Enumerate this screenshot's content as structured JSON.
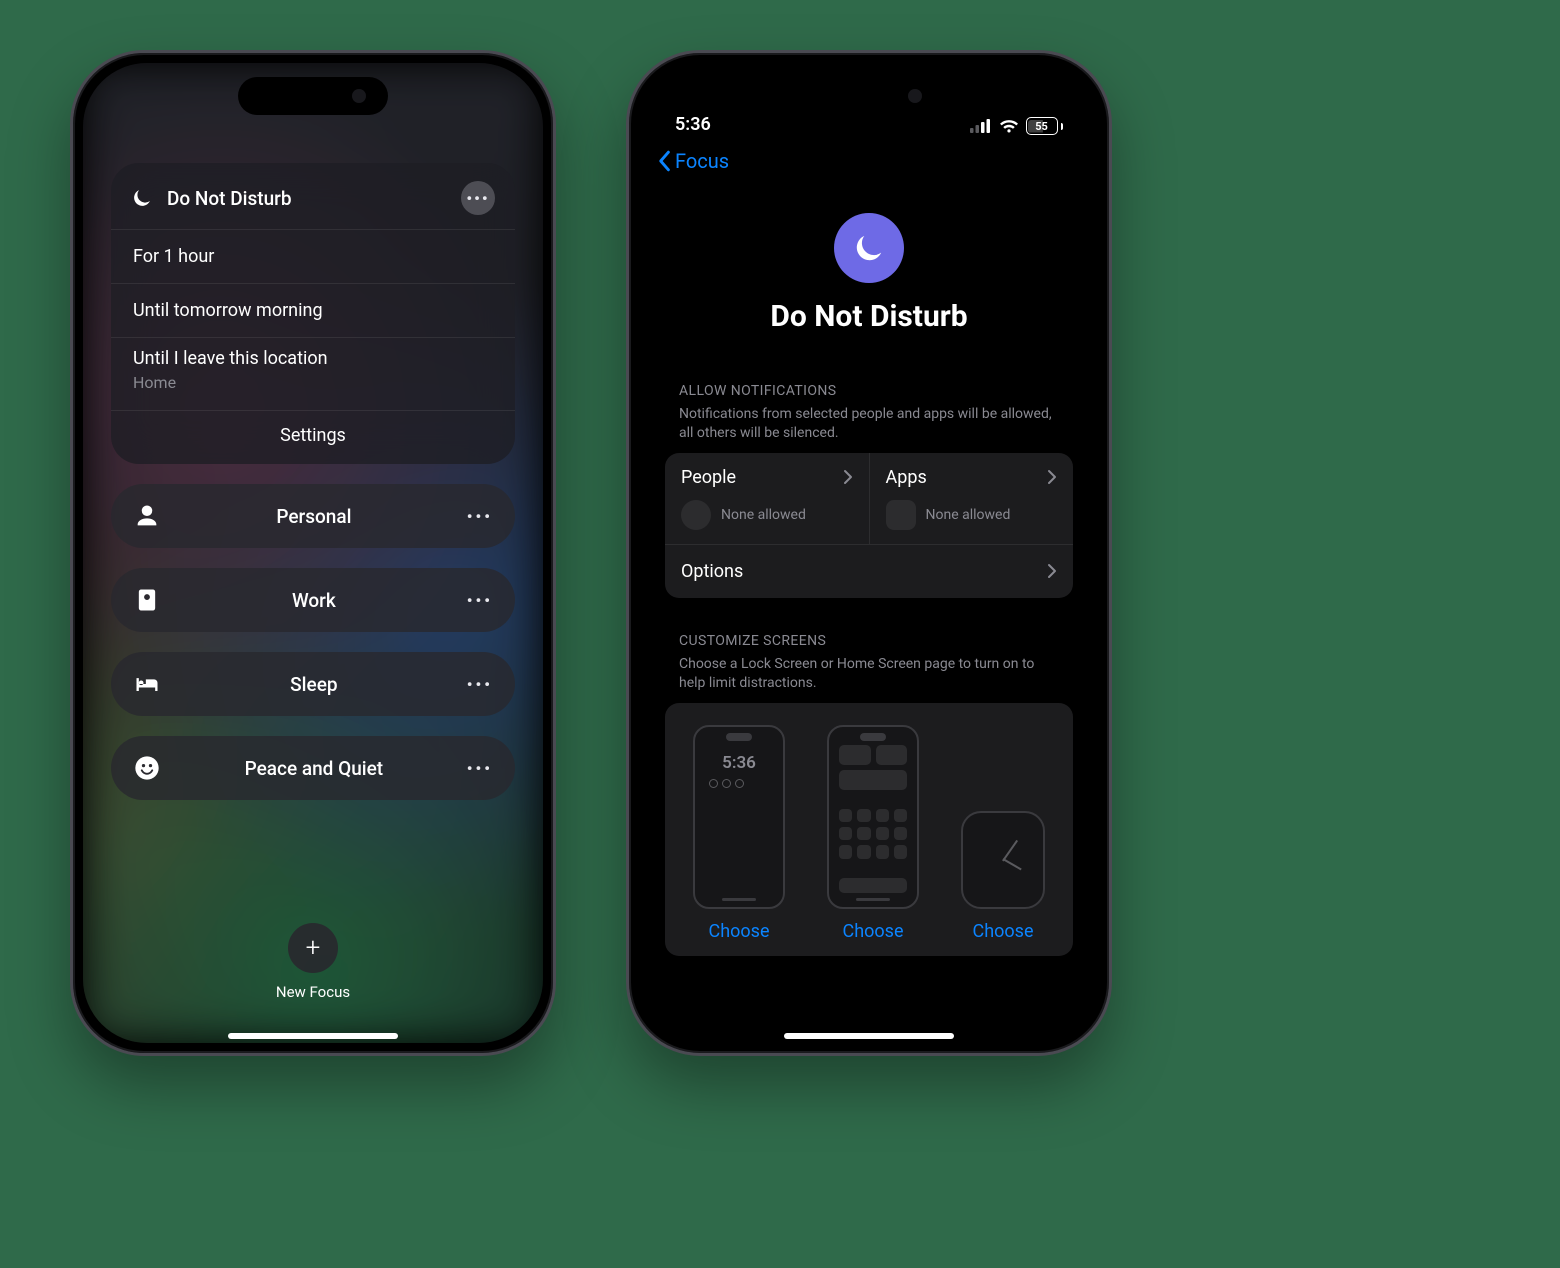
{
  "phone1": {
    "dnd": {
      "title": "Do Not Disturb",
      "rows": [
        "For 1 hour",
        "Until tomorrow morning"
      ],
      "location_row": "Until I leave this location",
      "location_sub": "Home",
      "settings": "Settings"
    },
    "focus_modes": [
      {
        "icon": "person",
        "label": "Personal"
      },
      {
        "icon": "badge",
        "label": "Work"
      },
      {
        "icon": "bed",
        "label": "Sleep"
      },
      {
        "icon": "smile",
        "label": "Peace and Quiet"
      }
    ],
    "new_focus": "New Focus"
  },
  "phone2": {
    "status": {
      "time": "5:36",
      "battery": "55"
    },
    "nav_back": "Focus",
    "hero_title": "Do Not Disturb",
    "allow": {
      "header": "ALLOW NOTIFICATIONS",
      "desc": "Notifications from selected people and apps will be allowed, all others will be silenced.",
      "people": "People",
      "apps": "Apps",
      "none": "None allowed",
      "options": "Options"
    },
    "customize": {
      "header": "CUSTOMIZE SCREENS",
      "desc": "Choose a Lock Screen or Home Screen page to turn on to help limit distractions.",
      "choose": "Choose",
      "lock_time": "5:36"
    }
  }
}
